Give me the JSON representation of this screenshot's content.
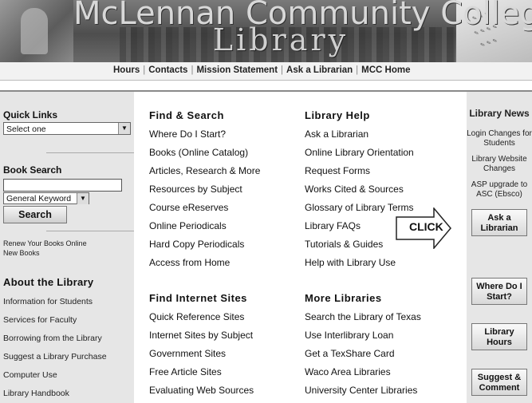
{
  "banner": {
    "title_line1": "McLennan Community College",
    "title_line2": "Library"
  },
  "nav": {
    "items": [
      "Hours",
      "Contacts",
      "Mission Statement",
      "Ask a Librarian",
      "MCC Home"
    ]
  },
  "left": {
    "quick_links": {
      "heading": "Quick Links",
      "select_value": "Select one"
    },
    "book_search": {
      "heading": "Book Search",
      "input_value": "",
      "type_value": "General Keyword",
      "button": "Search"
    },
    "renew": [
      "Renew Your Books Online",
      "New Books"
    ],
    "about": {
      "heading": "About the Library",
      "items": [
        "Information for Students",
        "Services for Faculty",
        "Borrowing from the Library",
        "Suggest a Library Purchase",
        "Computer Use",
        "Library Handbook"
      ]
    }
  },
  "find_search": {
    "heading": "Find & Search",
    "items": [
      "Where Do I Start?",
      "Books (Online Catalog)",
      "Articles, Research & More",
      "Resources by Subject",
      "Course eReserves",
      "Online Periodicals",
      "Hard Copy Periodicals",
      "Access from Home"
    ]
  },
  "library_help": {
    "heading": "Library Help",
    "items": [
      "Ask a Librarian",
      "Online Library Orientation",
      "Request Forms",
      "Works Cited & Sources",
      "Glossary of Library Terms",
      "Library FAQs",
      "Tutorials & Guides",
      "Help with Library Use"
    ]
  },
  "internet_sites": {
    "heading": "Find Internet Sites",
    "items": [
      "Quick Reference Sites",
      "Internet Sites by Subject",
      "Government Sites",
      "Free Article Sites",
      "Evaluating Web Sources"
    ]
  },
  "more_libraries": {
    "heading": "More Libraries",
    "items": [
      "Search the Library of Texas",
      "Use Interlibrary Loan",
      "Get a TexShare Card",
      "Waco Area Libraries",
      "University Center Libraries"
    ]
  },
  "right": {
    "news_heading": "Library News",
    "news_items": [
      "Login Changes for Students",
      "Library Website Changes",
      "ASP upgrade to ASC (Ebsco)"
    ],
    "buttons": [
      "Ask a Librarian",
      "Where Do I Start?",
      "Library Hours",
      "Suggest & Comment"
    ]
  },
  "callout": {
    "label": "CLICK"
  }
}
